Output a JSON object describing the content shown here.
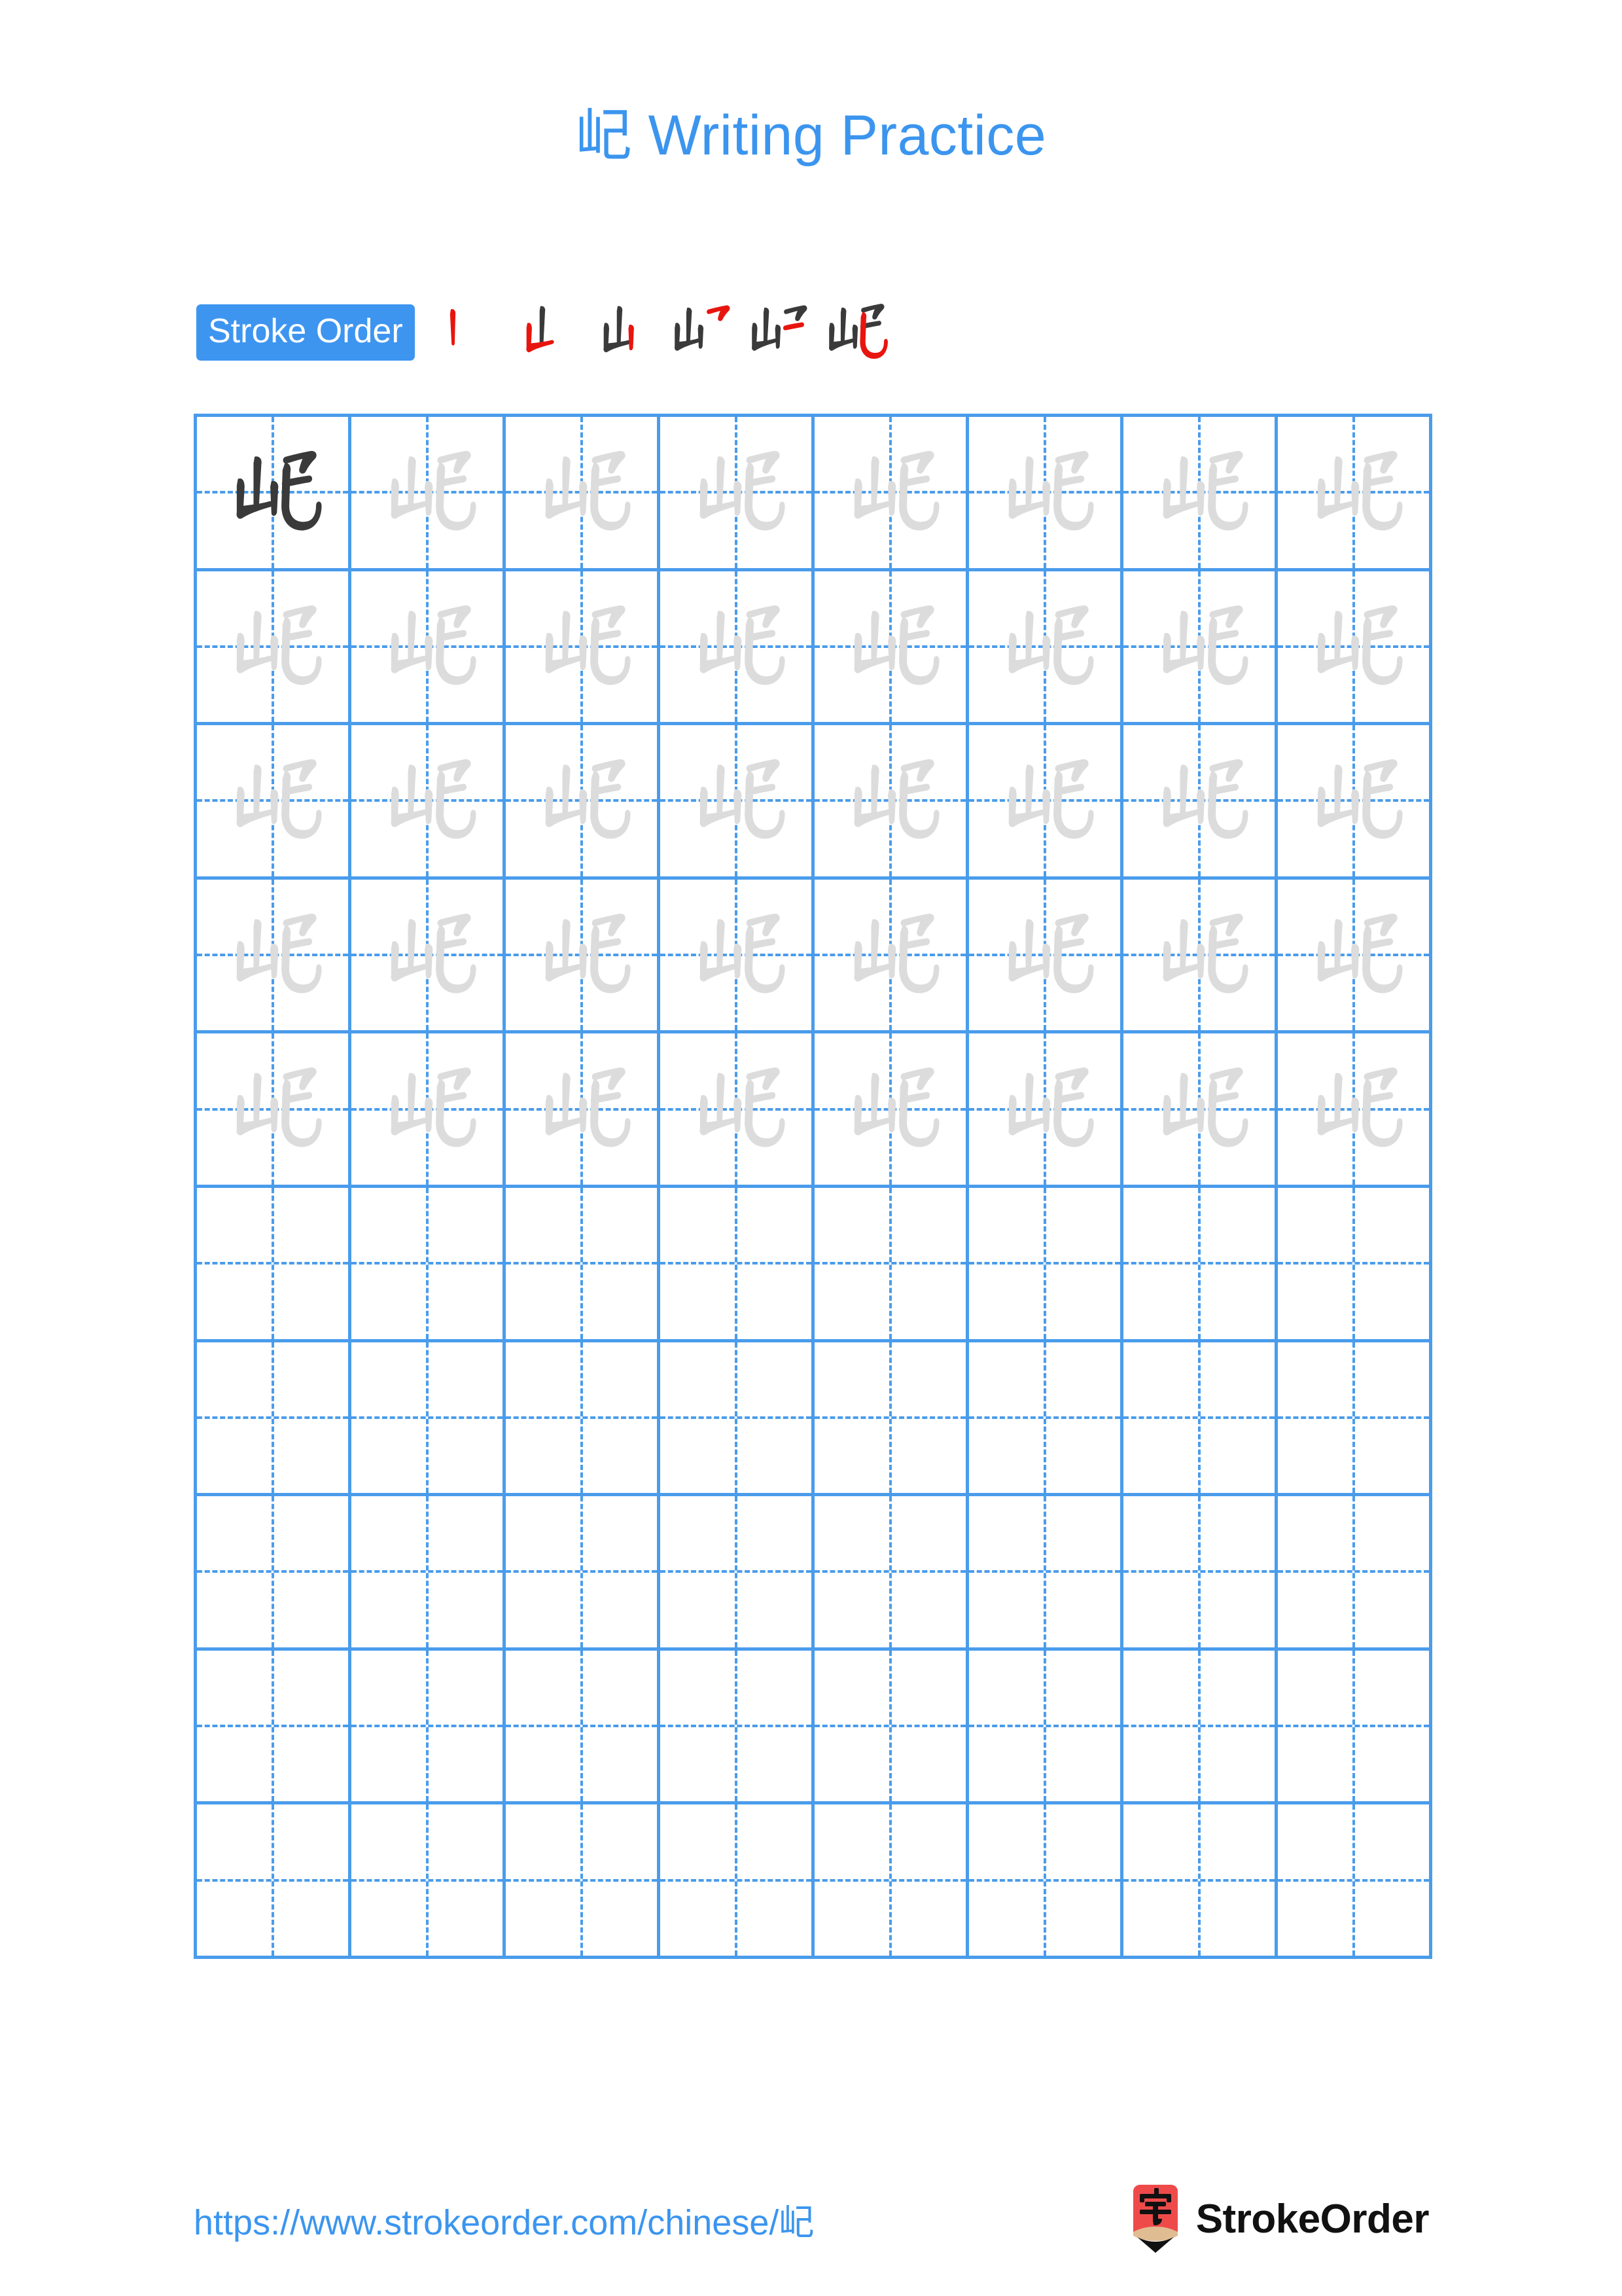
{
  "page": {
    "character": "屺",
    "title": "屺 Writing Practice",
    "background_color": "#ffffff",
    "accent_color": "#3b95ee",
    "grid_line_color": "#4a9ceb",
    "trace_char_color": "#dcdcdc",
    "primary_char_color": "#3a3a3a",
    "stroke_highlight_color": "#e8150f"
  },
  "stroke_order": {
    "badge_label": "Stroke Order",
    "badge_background": "#3d95f0",
    "badge_text_color": "#ffffff",
    "stroke_count": 6,
    "steps": [
      {
        "index": 1,
        "strokes_shown": 1,
        "new_stroke_color": "#e8150f",
        "prior_stroke_color": "#3a3a3a"
      },
      {
        "index": 2,
        "strokes_shown": 2,
        "new_stroke_color": "#e8150f",
        "prior_stroke_color": "#3a3a3a"
      },
      {
        "index": 3,
        "strokes_shown": 3,
        "new_stroke_color": "#e8150f",
        "prior_stroke_color": "#3a3a3a"
      },
      {
        "index": 4,
        "strokes_shown": 4,
        "new_stroke_color": "#e8150f",
        "prior_stroke_color": "#3a3a3a"
      },
      {
        "index": 5,
        "strokes_shown": 5,
        "new_stroke_color": "#e8150f",
        "prior_stroke_color": "#3a3a3a"
      },
      {
        "index": 6,
        "strokes_shown": 6,
        "new_stroke_color": "#e8150f",
        "prior_stroke_color": "#3a3a3a"
      }
    ]
  },
  "practice_grid": {
    "columns": 8,
    "rows": 10,
    "filled_rows": 5,
    "first_cell_style": "primary",
    "other_filled_cell_style": "trace",
    "empty_rows": 5,
    "guide_lines": "dashed-cross"
  },
  "footer": {
    "url": "https://www.strokeorder.com/chinese/屺",
    "brand_name": "StrokeOrder",
    "logo_character": "字",
    "logo_body_color": "#ef4a4a",
    "logo_wood_color": "#e0bc92",
    "logo_tip_color": "#111111"
  }
}
